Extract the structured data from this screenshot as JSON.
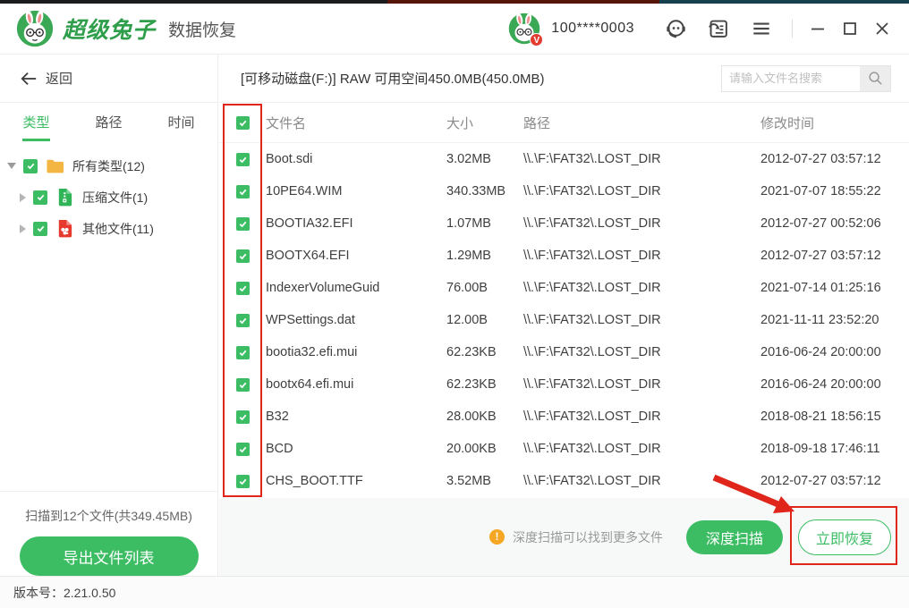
{
  "window": {
    "brand": "超级兔子",
    "product": "数据恢复",
    "account": "100****0003",
    "version_text": "版本号：2.21.0.50",
    "icons": [
      "rabbit-logo-icon",
      "avatar-rabbit-icon",
      "v-badge",
      "headset-support-icon",
      "feedback-icon",
      "hamburger-menu-icon",
      "minimize-icon",
      "maximize-icon",
      "close-icon"
    ]
  },
  "sidebar": {
    "back_label": "返回",
    "tabs": [
      {
        "label": "类型",
        "active": true
      },
      {
        "label": "路径",
        "active": false
      },
      {
        "label": "时间",
        "active": false
      }
    ],
    "tree": [
      {
        "label": "所有类型(12)",
        "icon": "folder-icon",
        "checked": true,
        "expanded": true
      },
      {
        "label": "压缩文件(1)",
        "icon": "archive-file-icon",
        "checked": true,
        "expanded": false
      },
      {
        "label": "其他文件(11)",
        "icon": "other-file-icon",
        "checked": true,
        "expanded": false
      }
    ],
    "scan_summary": "扫描到12个文件(共349.45MB)",
    "export_button": "导出文件列表"
  },
  "main": {
    "drive_info": "[可移动磁盘(F:)] RAW 可用空间450.0MB(450.0MB)",
    "search_placeholder": "请输入文件名搜索",
    "table": {
      "columns": {
        "name": "文件名",
        "size": "大小",
        "path": "路径",
        "mtime": "修改时间"
      },
      "rows": [
        {
          "name": "Boot.sdi",
          "size": "3.02MB",
          "path": "\\\\.\\F:\\FAT32\\.LOST_DIR",
          "mtime": "2012-07-27 03:57:12",
          "checked": true
        },
        {
          "name": "10PE64.WIM",
          "size": "340.33MB",
          "path": "\\\\.\\F:\\FAT32\\.LOST_DIR",
          "mtime": "2021-07-07 18:55:22",
          "checked": true
        },
        {
          "name": "BOOTIA32.EFI",
          "size": "1.07MB",
          "path": "\\\\.\\F:\\FAT32\\.LOST_DIR",
          "mtime": "2012-07-27 00:52:06",
          "checked": true
        },
        {
          "name": "BOOTX64.EFI",
          "size": "1.29MB",
          "path": "\\\\.\\F:\\FAT32\\.LOST_DIR",
          "mtime": "2012-07-27 03:57:12",
          "checked": true
        },
        {
          "name": "IndexerVolumeGuid",
          "size": "76.00B",
          "path": "\\\\.\\F:\\FAT32\\.LOST_DIR",
          "mtime": "2021-07-14 01:25:16",
          "checked": true
        },
        {
          "name": "WPSettings.dat",
          "size": "12.00B",
          "path": "\\\\.\\F:\\FAT32\\.LOST_DIR",
          "mtime": "2021-11-11 23:52:20",
          "checked": true
        },
        {
          "name": "bootia32.efi.mui",
          "size": "62.23KB",
          "path": "\\\\.\\F:\\FAT32\\.LOST_DIR",
          "mtime": "2016-06-24 20:00:00",
          "checked": true
        },
        {
          "name": "bootx64.efi.mui",
          "size": "62.23KB",
          "path": "\\\\.\\F:\\FAT32\\.LOST_DIR",
          "mtime": "2016-06-24 20:00:00",
          "checked": true
        },
        {
          "name": "B32",
          "size": "28.00KB",
          "path": "\\\\.\\F:\\FAT32\\.LOST_DIR",
          "mtime": "2018-08-21 18:56:15",
          "checked": true
        },
        {
          "name": "BCD",
          "size": "20.00KB",
          "path": "\\\\.\\F:\\FAT32\\.LOST_DIR",
          "mtime": "2018-09-18 17:46:11",
          "checked": true
        },
        {
          "name": "CHS_BOOT.TTF",
          "size": "3.52MB",
          "path": "\\\\.\\F:\\FAT32\\.LOST_DIR",
          "mtime": "2012-07-27 03:57:12",
          "checked": true
        }
      ]
    },
    "footer": {
      "hint": "深度扫描可以找到更多文件",
      "deep_scan_button": "深度扫描",
      "recover_button": "立即恢复"
    }
  },
  "annotations": {
    "highlight_color": "#e0251b",
    "items": [
      "red-box-around-checkbox-column",
      "red-arrow-to-recover-button",
      "red-box-around-recover-button"
    ]
  },
  "colors": {
    "accent_green": "#3cbd64",
    "logo_green": "#2f9e4b",
    "warning_orange": "#f5a623",
    "annotation_red": "#e0251b"
  }
}
